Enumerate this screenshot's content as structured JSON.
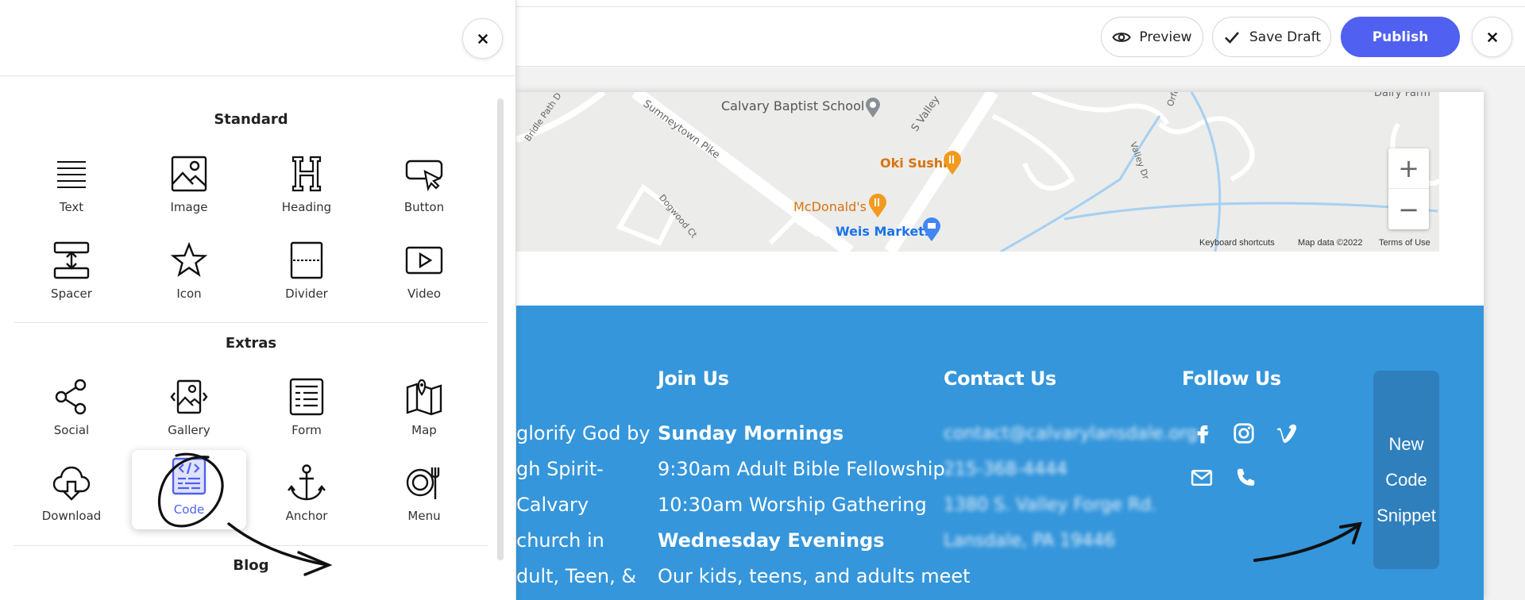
{
  "header": {
    "preview_label": "Preview",
    "save_draft_label": "Save Draft",
    "publish_label": "Publish"
  },
  "panel": {
    "sections": {
      "standard": "Standard",
      "extras": "Extras",
      "blog": "Blog"
    },
    "standard_items": [
      "Text",
      "Image",
      "Heading",
      "Button",
      "Spacer",
      "Icon",
      "Divider",
      "Video"
    ],
    "extras_items": [
      "Social",
      "Gallery",
      "Form",
      "Map",
      "Download",
      "Code",
      "Anchor",
      "Menu"
    ],
    "selected_item": "Code"
  },
  "map": {
    "labels": {
      "school": "Calvary Baptist School",
      "sushi": "Oki Sushi",
      "mcdonalds": "McDonald's",
      "weis": "Weis Markets",
      "road1": "Sumneytown Pike",
      "road2": "S Valley",
      "road3": "Dogwood Ct",
      "road4": "Bridle Path D",
      "road5": "Valley Dr",
      "road6": "Orfo",
      "road7": "Dairy Farm"
    },
    "zoom_in": "+",
    "zoom_out": "−",
    "attribution": {
      "shortcuts": "Keyboard shortcuts",
      "data": "Map data ©2022",
      "terms": "Terms of Use"
    }
  },
  "footer": {
    "about_lines": [
      "glorify God by",
      "gh Spirit-",
      "Calvary",
      "church in",
      "dult, Teen, &"
    ],
    "join": {
      "heading": "Join Us",
      "sunday_heading": "Sunday Mornings",
      "sunday_line1": "9:30am  Adult Bible Fellowship",
      "sunday_line2": "10:30am  Worship Gathering",
      "wednesday_heading": "Wednesday Evenings",
      "wednesday_line1": "Our kids, teens, and adults meet"
    },
    "contact": {
      "heading": "Contact Us",
      "email": "contact@calvarylansdale.org",
      "phone": "215-368-4444",
      "address1": "1380 S. Valley Forge Rd.",
      "address2": "Lansdale, PA 19446"
    },
    "follow": {
      "heading": "Follow Us"
    },
    "snippet_lines": [
      "New",
      "Code",
      "Snippet"
    ]
  },
  "colors": {
    "accent": "#5060f0",
    "footer_bg": "#3596db",
    "snippet_bg": "#2f7fbd"
  }
}
